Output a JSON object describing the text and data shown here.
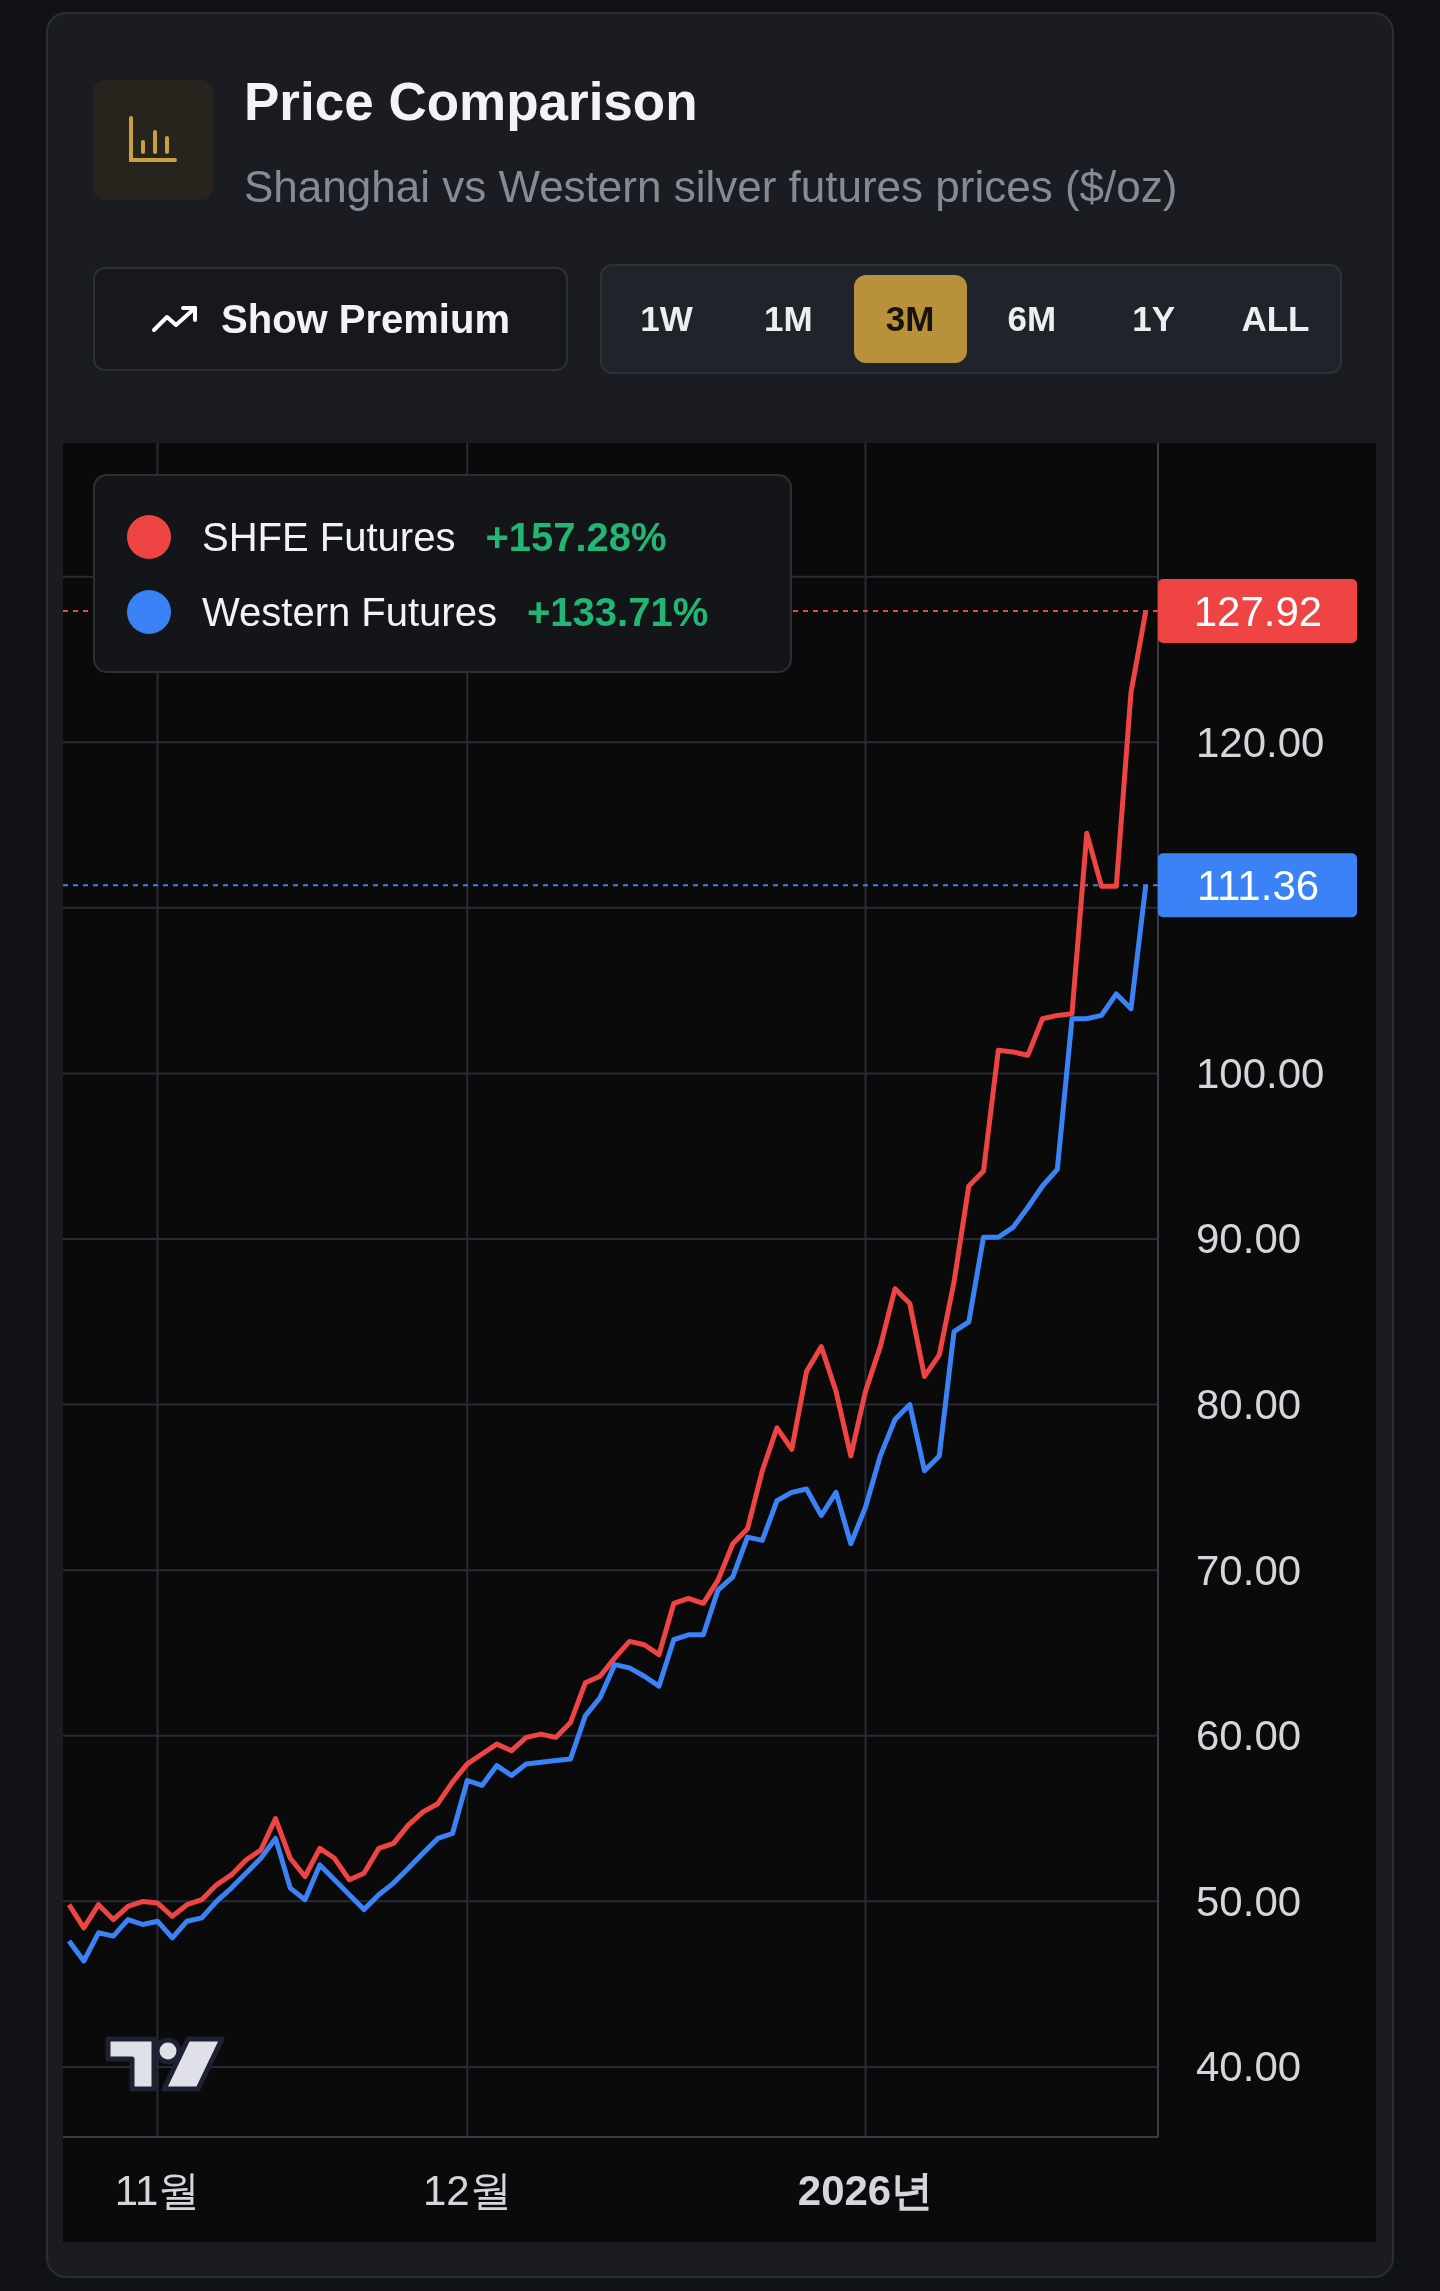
{
  "card": {
    "title": "Price Comparison",
    "subtitle": "Shanghai vs Western silver futures prices ($/oz)",
    "premium_button": {
      "label": "Show Premium"
    },
    "ranges": [
      {
        "label": "1W",
        "selected": false
      },
      {
        "label": "1M",
        "selected": false
      },
      {
        "label": "3M",
        "selected": true
      },
      {
        "label": "6M",
        "selected": false
      },
      {
        "label": "1Y",
        "selected": false
      },
      {
        "label": "ALL",
        "selected": false
      }
    ],
    "chart": {
      "tick_styles": [
        {
          "bold": false
        },
        {
          "bold": false
        },
        {
          "bold": true
        }
      ],
      "legend": [
        {
          "change": "+157.28%"
        },
        {
          "change": "+133.71%"
        }
      ],
      "chart_data": {
        "type": "line",
        "grid": true,
        "categories": [
          null,
          null,
          null,
          null,
          null,
          null,
          "11월",
          null,
          null,
          null,
          null,
          null,
          null,
          null,
          null,
          null,
          null,
          null,
          null,
          null,
          null,
          null,
          null,
          null,
          null,
          null,
          null,
          "12월",
          null,
          null,
          null,
          null,
          null,
          null,
          null,
          null,
          null,
          null,
          null,
          null,
          null,
          null,
          null,
          null,
          null,
          null,
          null,
          null,
          null,
          null,
          null,
          null,
          null,
          null,
          "2026년",
          null,
          null,
          null,
          null,
          null,
          null,
          null,
          null,
          null,
          null,
          null,
          null,
          null,
          null,
          null,
          null,
          null,
          null,
          null
        ],
        "ylim": [
          35.77,
          138.07
        ],
        "yticks": [
          {
            "value": 40,
            "label": "40.00"
          },
          {
            "value": 50,
            "label": "50.00"
          },
          {
            "value": 60,
            "label": "60.00"
          },
          {
            "value": 70,
            "label": "70.00"
          },
          {
            "value": 80,
            "label": "80.00"
          },
          {
            "value": 90,
            "label": "90.00"
          },
          {
            "value": 100,
            "label": "100.00"
          },
          {
            "value": 120,
            "label": "120.00"
          }
        ],
        "ref_lines": [
          {
            "axis": "y",
            "value": 127.92,
            "label": "127.92",
            "color": "#ef4444"
          },
          {
            "axis": "y",
            "value": 111.36,
            "label": "111.36",
            "color": "#3b82f6"
          }
        ],
        "series": [
          {
            "name": "SHFE Futures",
            "color": "#ef4444",
            "values": [
              49.8,
              48.4,
              49.8,
              48.9,
              49.7,
              50.0,
              49.9,
              49.1,
              49.8,
              50.1,
              51.0,
              51.6,
              52.5,
              53.1,
              55.0,
              52.6,
              51.5,
              53.2,
              52.6,
              51.3,
              51.7,
              53.2,
              53.5,
              54.6,
              55.4,
              55.9,
              57.2,
              58.3,
              58.9,
              59.5,
              59.1,
              59.9,
              60.1,
              59.9,
              60.8,
              63.2,
              63.6,
              64.7,
              65.7,
              65.5,
              64.9,
              68.0,
              68.3,
              68.0,
              69.4,
              71.6,
              72.5,
              76.0,
              78.6,
              77.3,
              82.0,
              83.5,
              80.8,
              76.9,
              80.8,
              83.5,
              87.0,
              86.1,
              81.7,
              83.0,
              87.4,
              93.2,
              94.1,
              101.4,
              101.3,
              101.1,
              103.3,
              103.5,
              103.6,
              114.5,
              111.3,
              111.3,
              123.0,
              127.92
            ]
          },
          {
            "name": "Western Futures",
            "color": "#3b82f6",
            "values": [
              47.6,
              46.4,
              48.1,
              47.9,
              48.9,
              48.6,
              48.8,
              47.8,
              48.8,
              49.0,
              50.0,
              50.8,
              51.7,
              52.6,
              53.8,
              50.8,
              50.1,
              52.2,
              51.3,
              50.4,
              49.5,
              50.4,
              51.1,
              52.0,
              52.9,
              53.8,
              54.1,
              57.3,
              57.0,
              58.2,
              57.6,
              58.3,
              58.4,
              58.5,
              58.6,
              61.2,
              62.3,
              64.3,
              64.1,
              63.6,
              63.0,
              65.8,
              66.1,
              66.1,
              68.8,
              69.6,
              72.0,
              71.8,
              74.2,
              74.7,
              74.9,
              73.3,
              74.7,
              71.6,
              73.8,
              76.9,
              79.1,
              80.0,
              76.0,
              76.9,
              84.4,
              85.0,
              90.1,
              90.1,
              90.7,
              91.9,
              93.2,
              94.2,
              103.3,
              103.3,
              103.5,
              104.8,
              103.9,
              111.36
            ]
          }
        ]
      }
    }
  }
}
